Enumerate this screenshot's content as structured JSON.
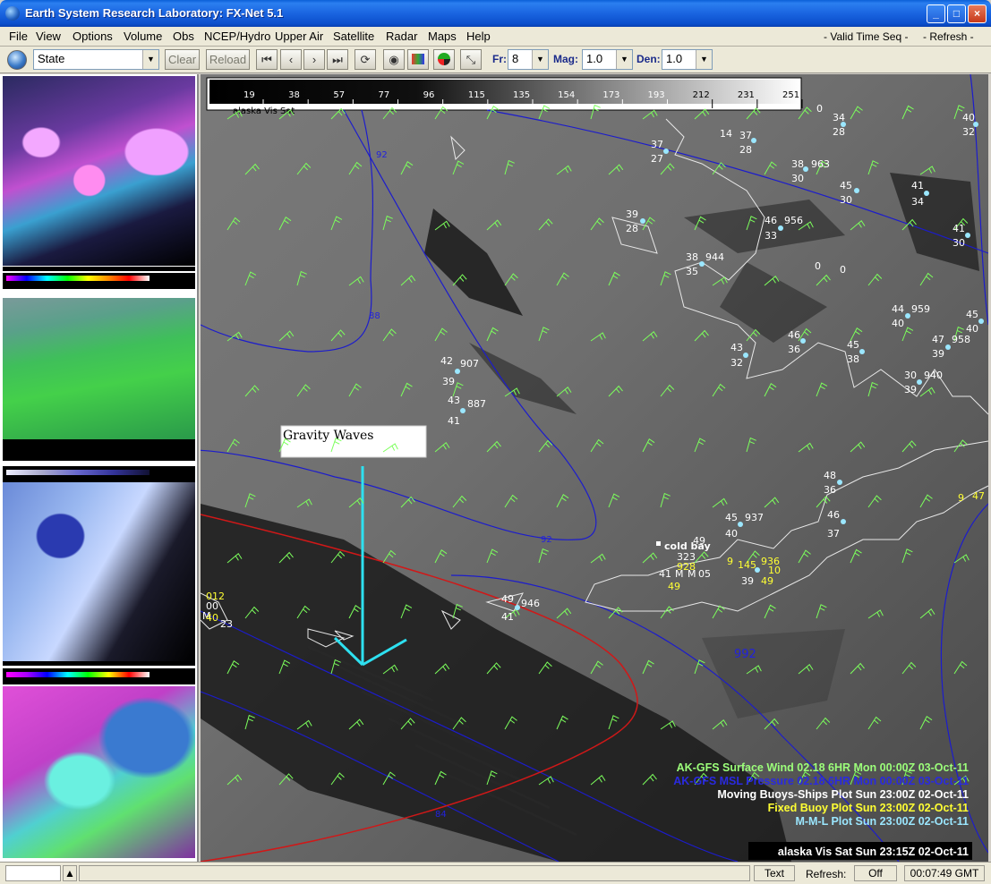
{
  "window": {
    "title": "Earth System Research Laboratory: FX-Net 5.1"
  },
  "menu": {
    "items": [
      "File",
      "View",
      "Options",
      "Volume",
      "Obs",
      "NCEP/Hydro",
      "Upper Air",
      "Satellite",
      "Radar",
      "Maps",
      "Help"
    ],
    "valid_time_seq": "- Valid Time Seq -",
    "refresh": "- Refresh -"
  },
  "toolbar": {
    "scale_select": "State",
    "clear_label": "Clear",
    "reload_label": "Reload",
    "fr_label": "Fr:",
    "fr_value": "8",
    "mag_label": "Mag:",
    "mag_value": "1.0",
    "den_label": "Den:",
    "den_value": "1.0"
  },
  "colorbar": {
    "ticks": [
      "19",
      "38",
      "57",
      "77",
      "96",
      "115",
      "135",
      "154",
      "173",
      "193",
      "212",
      "231",
      "251"
    ],
    "label": "alaska Vis Sat"
  },
  "annotation": {
    "text": "Gravity Waves"
  },
  "place_label": "cold bay",
  "legend": [
    {
      "text": "AK-GFS Surface Wind  02.18   6HR Mon 00:00Z 03-Oct-11",
      "color": "#9cff7a"
    },
    {
      "text": "AK-GFS MSL Pressure  02.18   6HR Mon 00:00Z 03-Oct-11",
      "color": "#2a2ae0"
    },
    {
      "text": "Moving Buoys-Ships Plot Sun 23:00Z 02-Oct-11",
      "color": "#ffffff"
    },
    {
      "text": "Fixed Buoy Plot Sun 23:00Z 02-Oct-11",
      "color": "#ffff33"
    },
    {
      "text": "M-M-L Plot Sun 23:00Z 02-Oct-11",
      "color": "#9be7ff"
    }
  ],
  "frame_time": "alaska Vis Sat Sun 23:15Z 02-Oct-11",
  "isobars": [
    "92",
    "88",
    "92",
    "84",
    "992"
  ],
  "stations": [
    {
      "id": "s1",
      "t": "37",
      "d": "27"
    },
    {
      "id": "s2",
      "t": "14",
      "t2": "37",
      "d": "28"
    },
    {
      "id": "s3",
      "t": "38",
      "p": "963",
      "d": "30"
    },
    {
      "id": "s4",
      "t": "45",
      "d": "30"
    },
    {
      "id": "s5",
      "t": "41",
      "d": "34"
    },
    {
      "id": "s6",
      "t": "34",
      "d": "28"
    },
    {
      "id": "s7",
      "t": "40",
      "d": "32"
    },
    {
      "id": "s8",
      "t": "39",
      "d": "28"
    },
    {
      "id": "s9",
      "t": "46",
      "p": "956",
      "d": "33"
    },
    {
      "id": "s10",
      "t": "41",
      "d": "30"
    },
    {
      "id": "s11",
      "t": "38",
      "p": "944",
      "d": "35"
    },
    {
      "id": "s12",
      "t": "44",
      "p": "959",
      "d": "40"
    },
    {
      "id": "s13",
      "t": "45",
      "d": "40"
    },
    {
      "id": "s14",
      "t": "46",
      "d": "36"
    },
    {
      "id": "s15",
      "t": "45",
      "d": "38"
    },
    {
      "id": "s16",
      "t": "47",
      "p": "958",
      "d": "39"
    },
    {
      "id": "s17",
      "t": "43",
      "d": "32"
    },
    {
      "id": "s18",
      "t": "30",
      "p": "940",
      "d": "39"
    },
    {
      "id": "s19",
      "t": "42",
      "p": "907",
      "d": "39"
    },
    {
      "id": "s20",
      "t": "43",
      "p": "887",
      "d": "41"
    },
    {
      "id": "s21",
      "t": "48",
      "d": "36"
    },
    {
      "id": "s22",
      "t": "46",
      "d": "37"
    },
    {
      "id": "s23",
      "t": "45",
      "p": "937",
      "d": "40"
    },
    {
      "id": "s24",
      "t": "49",
      "p": "946",
      "d": "41"
    },
    {
      "id": "s25",
      "t": "49",
      "d": ""
    }
  ],
  "zeros": [
    "0",
    "0",
    "0"
  ],
  "coldbay_obs": {
    "p1": "323",
    "p2": "928",
    "d": "49",
    "t2": "936",
    "p3": "10",
    "d2": "49",
    "d3": "39",
    "t": "41",
    "m": "M",
    "x": "M",
    "y": "05",
    "n": "9",
    "v": "10",
    "w": "145"
  },
  "west_obs": {
    "a": "012",
    "b": "00",
    "c": "M",
    "d": "40",
    "e": "23"
  },
  "east_obs": {
    "a": "9",
    "b": "47"
  },
  "statusbar": {
    "text_label": "Text",
    "refresh_label": "Refresh:",
    "refresh_value": "Off",
    "clock": "00:07:49 GMT"
  },
  "icons": {
    "app": "globe-icon",
    "first": "first-frame-icon",
    "prev": "prev-frame-icon",
    "next": "next-frame-icon",
    "last": "last-frame-icon",
    "loop": "loop-icon"
  }
}
